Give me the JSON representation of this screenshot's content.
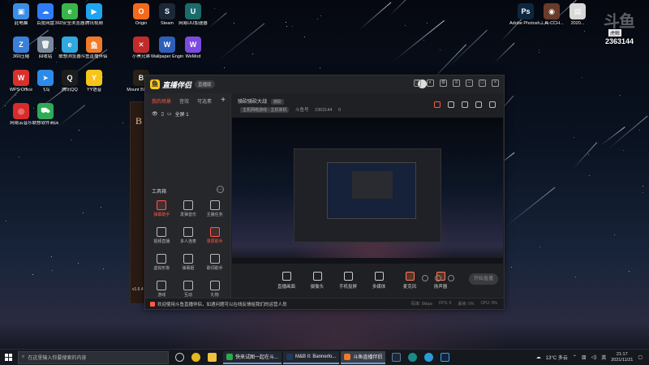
{
  "desktop": {
    "icons_col1": [
      {
        "label": "此电脑",
        "color": "#3a8ee6",
        "glyph": "▣"
      },
      {
        "label": "360压缩",
        "color": "#3a7fd8",
        "glyph": "Z"
      },
      {
        "label": "WPS Office",
        "color": "#d9302c",
        "glyph": "W"
      },
      {
        "label": "网易云音乐",
        "color": "#d92b2b",
        "glyph": "◎"
      }
    ],
    "icons_col2": [
      {
        "label": "百度网盘",
        "color": "#2f7cf6",
        "glyph": "☁"
      },
      {
        "label": "回收站",
        "color": "#7a8a9a",
        "glyph": "🗑"
      },
      {
        "label": "飞鸟",
        "color": "#2c8be8",
        "glyph": "➤"
      },
      {
        "label": "联想软件商店",
        "color": "#2faa55",
        "glyph": "⛟"
      }
    ],
    "icons_col3": [
      {
        "label": "360安全浏览器",
        "color": "#39b54a",
        "glyph": "e"
      },
      {
        "label": "联想浏览器",
        "color": "#2fa9e0",
        "glyph": "e"
      },
      {
        "label": "腾讯QQ",
        "color": "#1d1d1d",
        "glyph": "Q"
      }
    ],
    "icons_col4": [
      {
        "label": "腾讯视频",
        "color": "#1fa4f0",
        "glyph": "▶"
      },
      {
        "label": "斗鱼直播伴侣",
        "color": "#f07a28",
        "glyph": "鱼"
      },
      {
        "label": "YY语音",
        "color": "#f5c51a",
        "glyph": "Y"
      }
    ],
    "icons_col5": [
      {
        "label": "Origin",
        "color": "#f26a1b",
        "glyph": "O"
      },
      {
        "label": "小黑兄弟",
        "color": "#c22b2b",
        "glyph": "✕"
      },
      {
        "label": "Mount Blade II",
        "color": "#2a2218",
        "glyph": "B"
      }
    ],
    "icons_col6": [
      {
        "label": "Steam",
        "color": "#1b2838",
        "glyph": "S"
      },
      {
        "label": "Wallpaper Engine",
        "color": "#2e5fb8",
        "glyph": "W"
      }
    ],
    "icons_col7": [
      {
        "label": "网易UU加速器",
        "color": "#1a6b6a",
        "glyph": "U"
      },
      {
        "label": "WeMod",
        "color": "#7b4ae0",
        "glyph": "W"
      }
    ],
    "icons_right": [
      {
        "label": "Adobe Photosh...",
        "color": "#0d2740",
        "glyph": "Ps"
      },
      {
        "label": "工具-CCH...",
        "color": "#6a3b2a",
        "glyph": "◉"
      },
      {
        "label": "2020...",
        "color": "#d8d8d8",
        "glyph": "▤"
      }
    ]
  },
  "tv_widget": {
    "big": "斗鱼",
    "tag": "虎鲸",
    "num": "2363144"
  },
  "side_window": {
    "letter": "B",
    "version": "v1.6.4"
  },
  "app": {
    "title": "直播伴侣",
    "version": "直播版",
    "left_tabs": [
      "我的场景",
      "音效",
      "可选素"
    ],
    "scene_label": "全屏 1",
    "tools_title": "工具箱",
    "tools": [
      {
        "label": "弹幕助手",
        "active": true
      },
      {
        "label": "发弹音乐",
        "active": false
      },
      {
        "label": "主播任务",
        "active": false
      },
      {
        "label": "视频直播",
        "active": false
      },
      {
        "label": "多人连麦",
        "active": false
      },
      {
        "label": "录屏助手",
        "active": true
      },
      {
        "label": "虚拟形象",
        "active": false
      },
      {
        "label": "弹幕姬",
        "active": false
      },
      {
        "label": "歌词助手",
        "active": false
      },
      {
        "label": "游戏",
        "active": false
      },
      {
        "label": "互动",
        "active": false
      },
      {
        "label": "礼物",
        "active": false
      }
    ],
    "info": {
      "room_title": "骑砍骑砍大战",
      "tag": "骑砍",
      "category": "主机网络游戏 - 主机单机",
      "anchor": "斗鱼号",
      "room_id": "2363144",
      "fans": "0"
    },
    "bottom_controls": [
      "直播画面",
      "摄像头",
      "手机投屏",
      "多媒体",
      "麦克风",
      "扬声器"
    ],
    "go_live": "开始直播",
    "status_message": "欢迎使用斗鱼直播伴侣，如遇问题可以在线反馈给我们的运营人员",
    "stats": [
      "码率: 0kbps",
      "FPS: 0",
      "丢帧: 0%",
      "CPU: 0%"
    ]
  },
  "taskbar": {
    "search_placeholder": "在这里输入你要搜索的内容",
    "tasks": [
      {
        "label": "快来试图一起在斗...",
        "color": "#2ea84c",
        "active": false
      },
      {
        "label": "M&B II: Bannerlo...",
        "color": "#1e3a5a",
        "active": false
      },
      {
        "label": "斗鱼直播伴侣",
        "color": "#f07a28",
        "active": true
      }
    ],
    "weather": "13°C 多云",
    "lang": "英",
    "time": "21:17",
    "date": "2021/11/21"
  }
}
